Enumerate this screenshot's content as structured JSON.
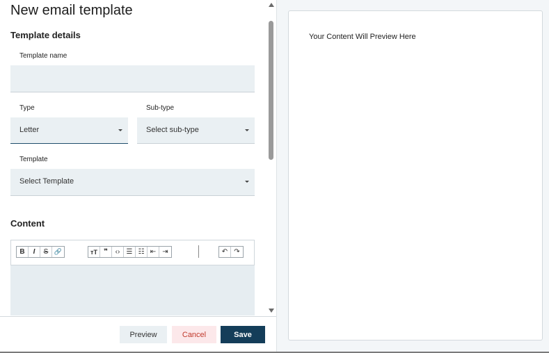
{
  "page": {
    "title": "New email template"
  },
  "template_details": {
    "section_title": "Template details",
    "template_name": {
      "label": "Template name",
      "value": "",
      "placeholder": ""
    },
    "type": {
      "label": "Type",
      "value": "Letter"
    },
    "sub_type": {
      "label": "Sub-type",
      "value": "Select sub-type"
    },
    "template": {
      "label": "Template",
      "value": "Select Template"
    }
  },
  "content": {
    "section_title": "Content",
    "toolbar": {
      "group1": [
        {
          "icon": "bold-icon",
          "glyph": "B"
        },
        {
          "icon": "italic-icon",
          "glyph": "I"
        },
        {
          "icon": "strikethrough-icon",
          "glyph": "S"
        },
        {
          "icon": "link-icon",
          "glyph": "🔗"
        }
      ],
      "group2": [
        {
          "icon": "heading-icon",
          "glyph": "тT"
        },
        {
          "icon": "quote-icon",
          "glyph": "❞"
        },
        {
          "icon": "code-icon",
          "glyph": "‹›"
        },
        {
          "icon": "bullet-list-icon",
          "glyph": "☰"
        },
        {
          "icon": "numbered-list-icon",
          "glyph": "☷"
        },
        {
          "icon": "outdent-icon",
          "glyph": "⇤"
        },
        {
          "icon": "indent-icon",
          "glyph": "⇥"
        }
      ],
      "group3": [
        {
          "icon": "undo-icon",
          "glyph": "↶"
        },
        {
          "icon": "redo-icon",
          "glyph": "↷"
        }
      ]
    }
  },
  "footer": {
    "preview_label": "Preview",
    "cancel_label": "Cancel",
    "save_label": "Save"
  },
  "preview": {
    "placeholder_text": "Your Content Will Preview Here"
  },
  "colors": {
    "field_bg": "#eaf0f3",
    "primary": "#143d59",
    "cancel_bg": "#fce8ea",
    "cancel_text": "#c0392b"
  }
}
